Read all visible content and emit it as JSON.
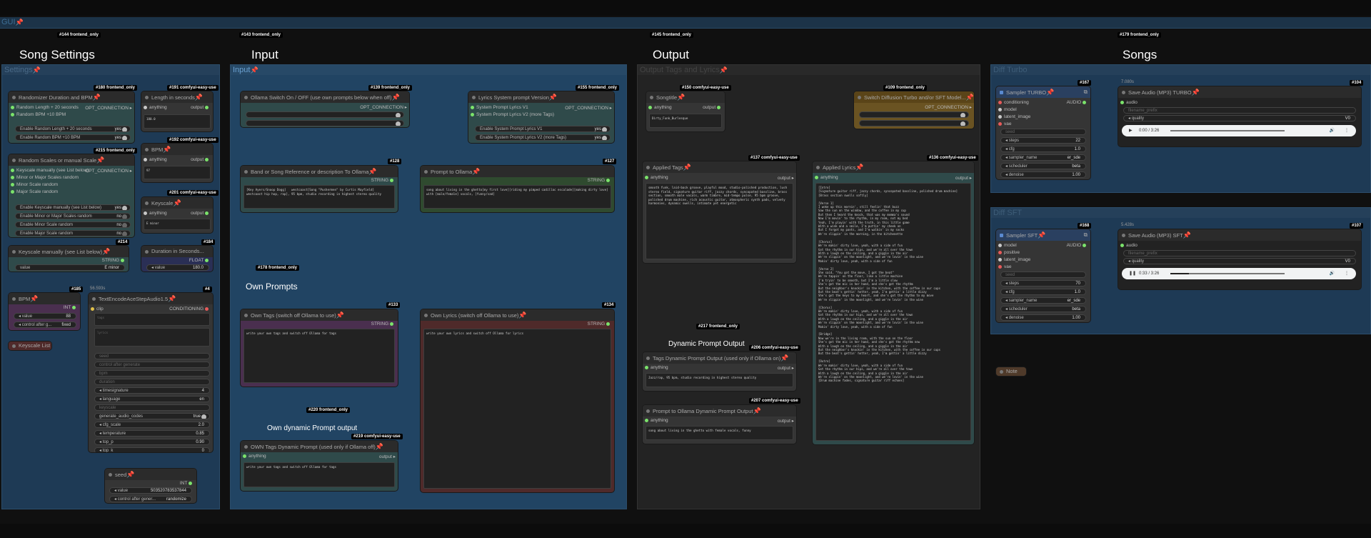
{
  "gui": {
    "label": "GUI",
    "pin": "📌"
  },
  "groups": {
    "settings": "Settings",
    "input": "Input",
    "output": "Output Tags and Lyrics",
    "turbo": "Diff Turbo",
    "sft": "Diff SFT"
  },
  "headers": {
    "song_settings": "Song Settings",
    "input": "Input",
    "output": "Output",
    "songs": "Songs",
    "own_prompts": "Own Prompts",
    "own_dynamic": "Own dynamic Prompt output",
    "dynamic_output": "Dynamic Prompt Output"
  },
  "badges": {
    "b144": "#144 frontend_only",
    "b143": "#143 frontend_only",
    "b145": "#145 frontend_only",
    "b179": "#179 frontend_only",
    "b180": "#180 frontend_only",
    "b191": "#191 comfyui-easy-use",
    "b215": "#215 frontend_only",
    "b192": "#192 comfyui-easy-use",
    "b201": "#201 comfyui-easy-use",
    "b214": "#214",
    "b184": "#184",
    "b185": "#185",
    "b4": "#4",
    "b139": "#139 frontend_only",
    "b155": "#155 frontend_only",
    "b128": "#128",
    "b127": "#127",
    "b178": "#178 frontend_only",
    "b133": "#133",
    "b134": "#134",
    "b220": "#220 frontend_only",
    "b219": "#219 comfyui-easy-use",
    "b150": "#150 comfyui-easy-use",
    "b109": "#109 frontend_only",
    "b137": "#137 comfyui-easy-use",
    "b136": "#136 comfyui-easy-use",
    "b217": "#217 frontend_only",
    "b206": "#206 comfyui-easy-use",
    "b207": "#207 comfyui-easy-use",
    "b167": "#167",
    "b104": "#104",
    "b168": "#168",
    "b107": "#107"
  },
  "timings": {
    "t1": "56.593s",
    "t2": "7.080s",
    "t3": "5.428s"
  },
  "nodes": {
    "randomizer": {
      "title": "Randomizer Duration and BPM",
      "s1": "Random Length + 20 seconds",
      "s2": "Random BPM +10 BPM",
      "out": "OPT_CONNECTION",
      "w1": "Enable Random Length + 20 seconds",
      "w2": "Enable Random BPM +10 BPM",
      "v1": "yes",
      "v2": "yes"
    },
    "length": {
      "title": "Length in seconds",
      "in": "anything",
      "out": "output",
      "text": "180.0"
    },
    "scales": {
      "title": "Random Scales or manual Scale",
      "s1": "Keyscale manually (see List below)",
      "s2": "Minor or Major Scales random",
      "s3": "Minor Scale random",
      "s4": "Major Scale random",
      "out": "OPT_CONNECTION",
      "w1": "Enable Keyscale manually (see List below)",
      "w2": "Enable Minor or Major Scales random",
      "w3": "Enable Minor Scale random",
      "w4": "Enable Major Scale random",
      "v1": "yes",
      "v2": "no",
      "v3": "no",
      "v4": "no"
    },
    "bpm": {
      "title": "BPM",
      "in": "anything",
      "out": "output",
      "text": "97"
    },
    "keyscale": {
      "title": "Keyscale",
      "in": "anything",
      "out": "output",
      "text": "E minor"
    },
    "keyscale_manual": {
      "title": "Keyscale manually (see List below)",
      "out": "STRING",
      "wl": "value",
      "wv": "E minor"
    },
    "duration": {
      "title": "Duration in Seconds...",
      "out": "FLOAT",
      "wl": "value",
      "wv": "180.0"
    },
    "bpm_int": {
      "title": "BPM",
      "out": "INT",
      "wl": "value",
      "wv": "88",
      "wl2": "control after g...",
      "wv2": "fixed"
    },
    "keyscale_list": {
      "title": "Keyscale List"
    },
    "textencode": {
      "title": "TextEncodeAceStepAudio1.5",
      "in": "clip",
      "out": "CONDITIONING",
      "f1": "tags",
      "f2": "lyrics",
      "f3": "seed",
      "f4": "control after generate",
      "f5": "bpm",
      "f6": "duration",
      "w1": "timesignature",
      "v1": "4",
      "w2": "language",
      "v2": "en",
      "f7": "keyscale",
      "w3": "generate_audio_codes",
      "v3": "true",
      "w4": "cfg_scale",
      "v4": "2.0",
      "w5": "temperature",
      "v5": "0.85",
      "w6": "top_p",
      "v6": "0.90",
      "w7": "top_k",
      "v7": "0"
    },
    "seed": {
      "title": "seed",
      "out": "INT",
      "wl": "value",
      "wv": "503520783537844",
      "wl2": "control after gener...",
      "wv2": "randomize"
    },
    "ollama_switch": {
      "title": "Ollama Switch On / OFF  (use own prompts below when off)",
      "out": "OPT_CONNECTION"
    },
    "lyrics_sys": {
      "title": "Lyrics System prompt Version",
      "s1": "System Prompt Lyrics V1",
      "s2": "System Prompt Lyrics V2 (more Tags)",
      "out": "OPT_CONNECTION",
      "w1": "Enable System Prompt Lyrics V1",
      "w2": "Enable System Prompt Lyrics V2 (more Tags)",
      "v1": "yes",
      "v2": "yes"
    },
    "band_ref": {
      "title": "Band or Song Reference or description To Ollama",
      "out": "STRING",
      "text": "[Key Ayers/Snoop Dogg]   westcoast[Song \"Pushermen\" by Curtis Mayfield]   westcoast hip hop, rap], 95 bpm, studio recording in highest stereo quality"
    },
    "prompt_ollama": {
      "title": "Prompt to Ollama",
      "out": "STRING",
      "text": "song about living in the ghetto[my first love][riding my pimped cadillac escalade][making dirty love] with [male/female] vocals, [funny/sad]"
    },
    "own_tags": {
      "title": "Own Tags (switch off Ollama to use)",
      "out": "STRING",
      "text": "write your own tags and switch off Ollama for tags"
    },
    "own_lyrics": {
      "title": "Own Lyrics (switch off Ollama to use)",
      "out": "STRING",
      "text": "write your own lyrics and switch off Ollama for lyrics"
    },
    "own_dyn": {
      "title": "OWN Tags Dynamic Prompt (used only if Ollama off)",
      "in": "anything",
      "out": "output",
      "text": "write your own tags and switch off Ollama for tags"
    },
    "songtitle": {
      "title": "Songtitle",
      "in": "anything",
      "out": "output",
      "text": "Dirty_Funk_Burlesque"
    },
    "switch_diff": {
      "title": "Switch Diffusion Turbo and/or SFT Model...",
      "out": "OPT_CONNECTION"
    },
    "applied_tags": {
      "title": "Applied Tags",
      "in": "anything",
      "out": "output",
      "text": "smooth funk, laid-back groove, playful mood, studio-polished production, lush stereo field, signature guitar riff, jazzy chords, syncopated bassline, brass section, smooth male vocals, warm timbre, mid-tempo pulse, 95 bpm groove, polished drum machine, rich acoustic guitar, atmospheric synth pads, velvety harmonies, dynamic swells, intimate yet energetic"
    },
    "applied_lyrics": {
      "title": "Applied Lyrics",
      "in": "anything",
      "out": "output",
      "text": "[Intro]\n[Signature guitar riff, jazzy chords, syncopated bassline, polished drum machine]\n[Brass section swells softly]\n\n[Verse 1]\nI woke up this mornin', still feelin' that buzz\nSaw the sun on the window, and the coffee in my cup\nBut then I heard the knock, that was my momma's sound\nNow I'm movin' to the rhythm, in my room, not my bed\nYeah, I'm playin' with the truth, in this little game\nWith a wink and a smile, I'm puttin' my cheek on\nBut I forgot my pants, and I'm walkin' in my socks\nWe're slippin' in the morning, in the kitchenette\n\n[Chorus]\nWe're makin' dirty love, yeah, with a side of fun\nGot the rhythm in our hips, and we're all over the town\nWith a laugh on the ceiling, and a giggle in the air\nWe're slippin' on the moonlight, and we're lovin' in the wine\nMakin' dirty love, yeah, with a side of fun\n\n[Verse 2]\nShe said, \"You got the move, I got the beat\"\nWe're tappin' on the floor, like a little machine\nI'm tryin' to be smooth, but I'm a little slow\nShe's got the mic in her hand, and she's got the rhythm\nBut the neighbor's knockin' in the kitchen, with the coffee in our cups\nBut the beat's gettin' hotter, yeah, I'm gettin' a little dizzy\nShe's got the keys to my heart, and she's got the rhythm to my move\nWe're slippin' in the moonlight, and we're lovin' in the wine\n\n[Chorus]\nWe're makin' dirty love, yeah, with a side of fun\nGot the rhythm in our hips, and we're all over the town\nWith a laugh on the ceiling, and a giggle in the air\nWe're slippin' on the moonlight, and we're lovin' in the wine\nMakin' dirty love, yeah, with a side of fun\n\n[Bridge]\nNow we're in the living room, with the sun on the floor\nShe's got the mic in her hand, and she's got the rhythm now\nWith a laugh on the ceiling, and a giggle in the air\nBut the neighbor's knockin' in the kitchen, with the coffee in our cups\nBut the beat's gettin' hotter, yeah, I'm gettin' a little dizzy\n\n[Outro]\nWe're makin' dirty love, yeah, with a side of fun\nGot the rhythm in our hips, and we're all over the town\nWith a laugh on the ceiling, and a giggle in the air\nWe're slippin' on the moonlight, and we're lovin' in the wine\n[Drum machine fades, signature guitar riff echoes]"
    },
    "tags_dyn": {
      "title": "Tags Dynamic Prompt Output (used only if Ollama on)",
      "in": "anything",
      "out": "output",
      "text": "Jazz/rap, 95 bpm, studio recording in highest stereo quality"
    },
    "prompt_dyn": {
      "title": "Prompt to Ollama Dynamic Prompt Output",
      "in": "anything",
      "out": "output",
      "text": "song about living in the ghetto with female vocals, funny"
    },
    "sampler_turbo": {
      "title": "Sampler TURBO",
      "i1": "conditioning",
      "i2": "model",
      "i3": "latent_image",
      "i4": "vae",
      "out": "AUDIO",
      "f1": "seed",
      "w1": "steps",
      "v1": "22",
      "w2": "cfg",
      "v2": "1.0",
      "w3": "sampler_name",
      "v3": "er_sde",
      "w4": "scheduler",
      "v4": "beta",
      "w5": "denoise",
      "v5": "1.00"
    },
    "save_turbo": {
      "title": "Save Audio (MP3) TURBO",
      "in": "audio",
      "f1": "filename_prefix",
      "w1": "quality",
      "v1": "V0",
      "time": "0:00 / 3:26"
    },
    "sampler_sft": {
      "title": "Sampler SFT",
      "i1": "model",
      "i2": "positive",
      "i3": "latent_image",
      "i4": "vae",
      "out": "AUDIO",
      "f1": "seed",
      "w1": "steps",
      "v1": "70",
      "w2": "cfg",
      "v2": "1.0",
      "w3": "sampler_name",
      "v3": "er_sde",
      "w4": "scheduler",
      "v4": "beta",
      "w5": "denoise",
      "v5": "1.00"
    },
    "save_sft": {
      "title": "Save Audio (MP3) SFT",
      "in": "audio",
      "f1": "filename_prefix",
      "w1": "quality",
      "v1": "V0",
      "time": "0:33 / 3:26"
    },
    "note": {
      "title": "Note"
    }
  },
  "colors": {
    "group_blue": "#1e3a55",
    "node_teal": "#2f4a4a",
    "node_purple": "#4a2f4f",
    "node_red": "#4f2a2a",
    "node_green": "#2f4a2f",
    "node_gold": "#6a5322",
    "node_blue_hdr": "#2a4060"
  },
  "audio": {
    "turbo_progress": 0.0,
    "sft_progress": 0.16
  }
}
